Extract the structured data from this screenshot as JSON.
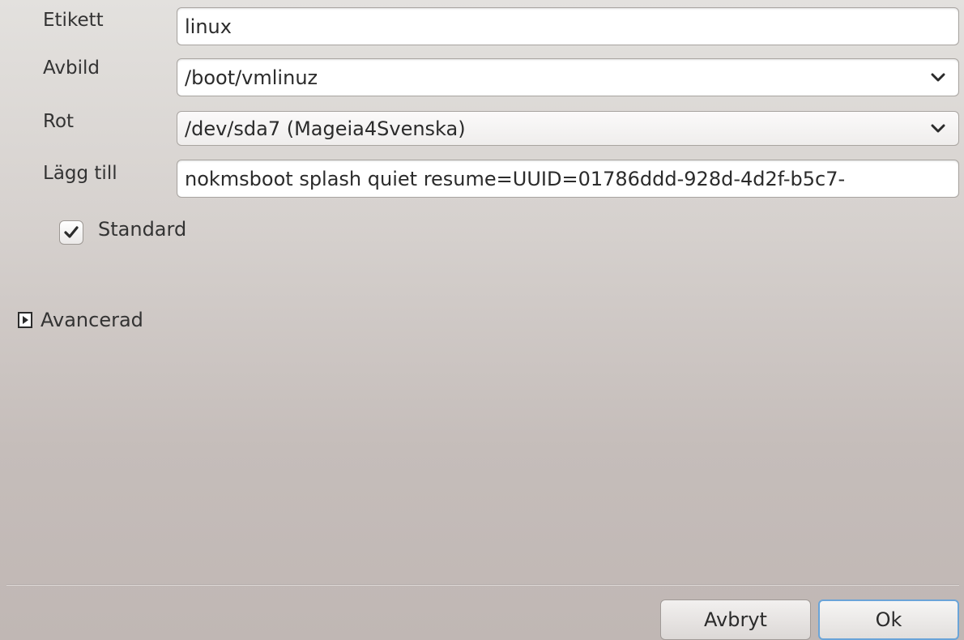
{
  "form": {
    "label_label": "Etikett",
    "label_value": "linux",
    "image_label": "Avbild",
    "image_value": "/boot/vmlinuz",
    "root_label": "Rot",
    "root_value": "/dev/sda7 (Mageia4Svenska)",
    "append_label": "Lägg till",
    "append_value": "nokmsboot splash quiet resume=UUID=01786ddd-928d-4d2f-b5c7-",
    "default_label": "Standard",
    "default_checked": true
  },
  "advanced": {
    "label": "Avancerad",
    "expanded": false
  },
  "buttons": {
    "cancel": "Avbryt",
    "ok": "Ok"
  },
  "icons": {
    "combo_arrow": "chevron-down-icon",
    "checkbox_mark": "checkmark-icon",
    "expander": "triangle-right-icon"
  }
}
